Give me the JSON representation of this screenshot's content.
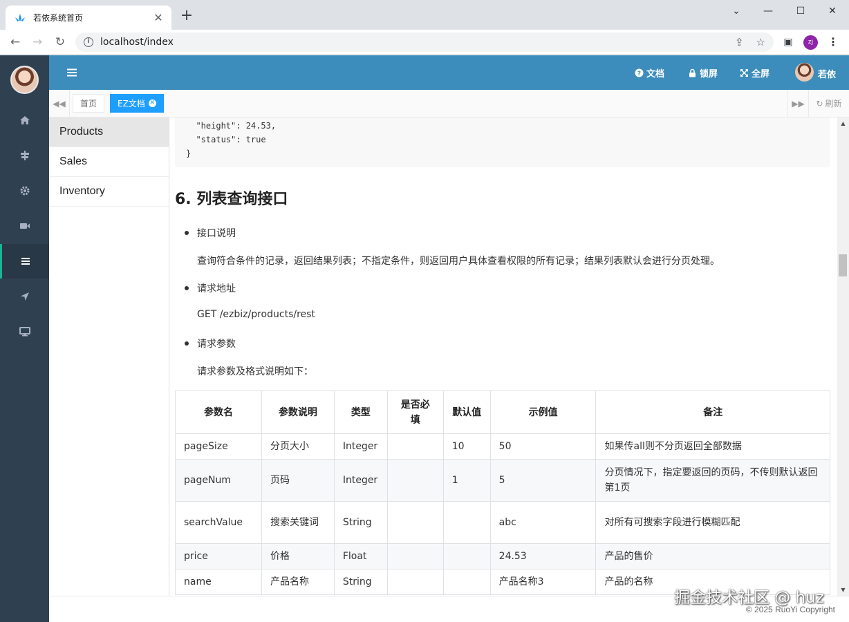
{
  "browser": {
    "tab_title": "若依系统首页",
    "tab_close": "✕",
    "new_tab": "+",
    "url": "localhost/index",
    "profile_initials": "zj",
    "win_min": "—",
    "win_max": "☐",
    "win_close": "✕",
    "chevron": "⌄"
  },
  "header": {
    "docs": "文档",
    "lock": "锁屏",
    "fullscreen": "全屏",
    "user": "若依"
  },
  "tabs": [
    {
      "label": "首页"
    },
    {
      "label": "EZ文档",
      "close": "✕"
    }
  ],
  "tabbar": {
    "refresh": "刷新"
  },
  "docnav": [
    {
      "label": "Products"
    },
    {
      "label": "Sales"
    },
    {
      "label": "Inventory"
    }
  ],
  "content": {
    "code_lines": "  \"height\": 24.53,\n  \"status\": true\n}",
    "section_title": "6. 列表查询接口",
    "bullet1": "接口说明",
    "desc": "查询符合条件的记录，返回结果列表；不指定条件，则返回用户具体查看权限的所有记录；结果列表默认会进行分页处理。",
    "bullet2": "请求地址",
    "endpoint": "GET /ezbiz/products/rest",
    "bullet3": "请求参数",
    "param_intro": "请求参数及格式说明如下："
  },
  "table": {
    "headers": [
      "参数名",
      "参数说明",
      "类型",
      "是否必填",
      "默认值",
      "示例值",
      "备注"
    ],
    "rows": [
      [
        "pageSize",
        "分页大小",
        "Integer",
        "",
        "10",
        "50",
        "如果传all则不分页返回全部数据"
      ],
      [
        "pageNum",
        "页码",
        "Integer",
        "",
        "1",
        "5",
        "分页情况下，指定要返回的页码，不传则默认返回第1页"
      ],
      [
        "searchValue",
        "搜索关键词",
        "String",
        "",
        "",
        "abc",
        "对所有可搜索字段进行模糊匹配"
      ],
      [
        "price",
        "价格",
        "Float",
        "",
        "",
        "24.53",
        "产品的售价"
      ],
      [
        "name",
        "产品名称",
        "String",
        "",
        "",
        "产品名称3",
        "产品的名称"
      ]
    ]
  },
  "footer": {
    "copyright": "© 2025 RuoYi Copyright"
  },
  "watermark": "掘金技术社区 @ huz",
  "colors": {
    "sidebar": "#2f4050",
    "topbar": "#3c8dbc",
    "tab_active": "#1e9fff"
  }
}
